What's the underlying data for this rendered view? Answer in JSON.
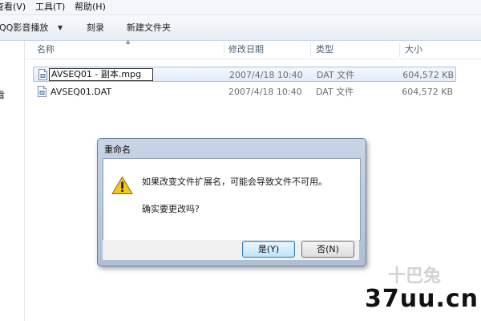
{
  "menu": {
    "items": [
      "查看(V)",
      "工具(T)",
      "帮助(H)"
    ]
  },
  "toolbar": {
    "play_label": "用QQ影音播放",
    "play_dropdown_icon": "dropdown-arrow-icon",
    "burn_label": "刻录",
    "new_folder_label": "新建文件夹"
  },
  "nav": {
    "visible_item": "看"
  },
  "columns": {
    "name": "名称",
    "date": "修改日期",
    "type": "类型",
    "size": "大小"
  },
  "files": [
    {
      "name": "AVSEQ01 - 副本.mpg",
      "date": "2007/4/18 10:40",
      "type": "DAT 文件",
      "size": "604,572 KB",
      "icon": "file-icon",
      "renaming": true
    },
    {
      "name": "AVSEQ01.DAT",
      "date": "2007/4/18 10:40",
      "type": "DAT 文件",
      "size": "604,572 KB",
      "icon": "file-icon",
      "renaming": false
    }
  ],
  "dialog": {
    "title": "重命名",
    "icon": "warning-icon",
    "message_line1": "如果改变文件扩展名，可能会导致文件不可用。",
    "message_line2": "确实要更改吗?",
    "yes_label": "是(Y)",
    "no_label": "否(N)"
  },
  "watermark": {
    "site": "37uu.cn",
    "logo_text": "十巴兔"
  },
  "colors": {
    "selection_border": "#a9c1e5",
    "dialog_frame": "#aebfd6",
    "default_button_border": "#3c7fb1"
  }
}
